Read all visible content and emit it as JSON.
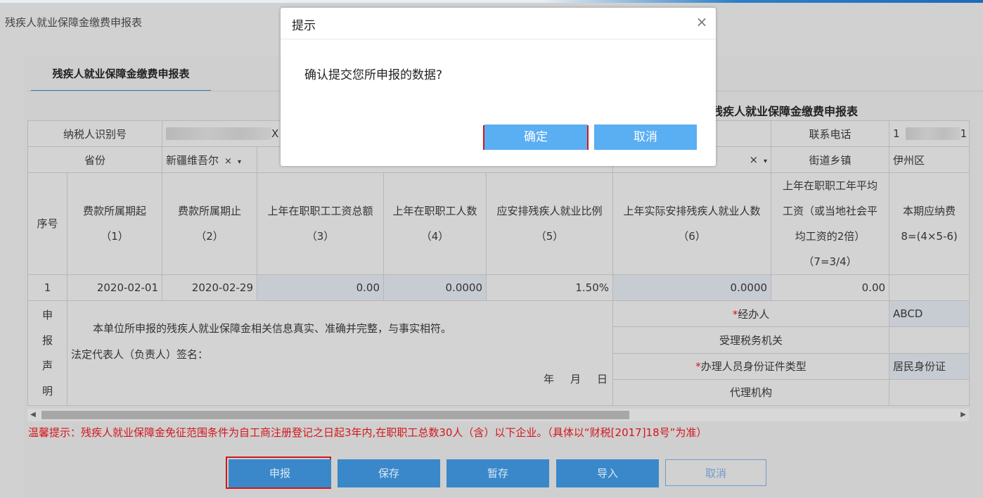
{
  "page": {
    "title": "残疾人就业保障金缴费申报表",
    "tab_label": "残疾人就业保障金缴费申报表",
    "form_title": "残疾人就业保障金缴费申报表"
  },
  "info": {
    "taxpayer_id_label": "纳税人识别号",
    "taxpayer_id_tail": "X",
    "phone_label": "联系电话",
    "phone_head": "1",
    "phone_tail": "1",
    "province_label": "省份",
    "province_value": "新疆维吾尔",
    "street_label": "街道乡镇",
    "street_value": "伊州区",
    "clear_symbol": "×",
    "caret_symbol": "▾"
  },
  "columns": [
    {
      "name": "序号",
      "no": ""
    },
    {
      "name": "费款所属期起",
      "no": "（1）"
    },
    {
      "name": "费款所属期止",
      "no": "（2）"
    },
    {
      "name": "上年在职职工工资总额",
      "no": "（3）"
    },
    {
      "name": "上年在职职工人数",
      "no": "（4）"
    },
    {
      "name": "应安排残疾人就业比例",
      "no": "（5）"
    },
    {
      "name": "上年实际安排残疾人就业人数",
      "no": "（6）"
    },
    {
      "name": "上年在职职工年平均工资（或当地社会平均工资的2倍）",
      "no": "（7=3/4）"
    },
    {
      "name": "本期应纳费",
      "no": "8=(4×5-6)"
    }
  ],
  "row": {
    "index": "1",
    "period_start": "2020-02-01",
    "period_end": "2020-02-29",
    "total_wages": "0.00",
    "staff_count": "0.0000",
    "ratio": "1.50%",
    "disabled_count": "0.0000",
    "avg_wage": "0.00"
  },
  "declaration": {
    "label_chars": [
      "申",
      "报",
      "声",
      "明"
    ],
    "statement": "本单位所申报的残疾人就业保障金相关信息真实、准确并完整，与事实相符。",
    "signature": "法定代表人（负责人）签名：",
    "date_year": "年",
    "date_month": "月",
    "date_day": "日",
    "handler_label": "经办人",
    "handler_value": "ABCD",
    "tax_office_label": "受理税务机关",
    "id_type_label": "办理人员身份证件类型",
    "id_type_value": "居民身份证",
    "agency_label": "代理机构",
    "required_mark": "*"
  },
  "notice": "温馨提示：残疾人就业保障金免征范围条件为自工商注册登记之日起3年内,在职职工总数30人（含）以下企业。（具体以“财税[2017]18号”为准）",
  "buttons": {
    "submit": "申报",
    "save": "保存",
    "temp_save": "暂存",
    "import": "导入",
    "cancel": "取消"
  },
  "dialog": {
    "title": "提示",
    "message": "确认提交您所申报的数据?",
    "ok": "确定",
    "cancel": "取消",
    "close_symbol": "×"
  },
  "scroll": {
    "left_symbol": "◀",
    "right_symbol": "▶"
  },
  "colors": {
    "accent": "#2b7fc8",
    "button": "#3a88c9",
    "dialog_button": "#5aaef2",
    "warning": "#d4161c"
  }
}
